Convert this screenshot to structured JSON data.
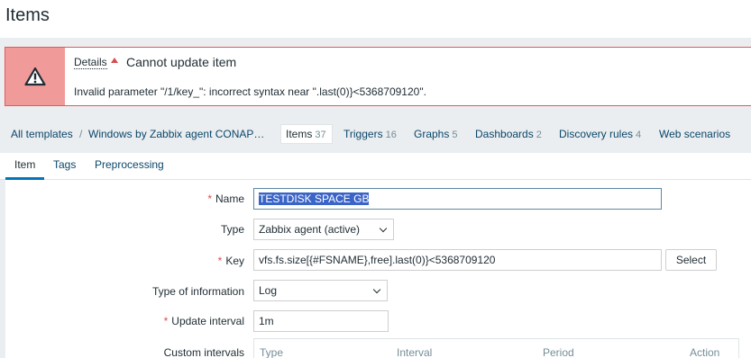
{
  "page": {
    "title": "Items"
  },
  "message": {
    "details_label": "Details",
    "title": "Cannot update item",
    "detail": "Invalid parameter \"/1/key_\": incorrect syntax near \".last(0)}<5368709120\".",
    "colors": {
      "border": "#e45959",
      "icon_bg": "#f19a9a"
    }
  },
  "nav": {
    "all_templates": "All templates",
    "separator": "/",
    "template": "Windows by Zabbix agent CONAP…",
    "items_label": "Items",
    "items_count": "37",
    "triggers_label": "Triggers",
    "triggers_count": "16",
    "graphs_label": "Graphs",
    "graphs_count": "5",
    "dashboards_label": "Dashboards",
    "dashboards_count": "2",
    "discovery_label": "Discovery rules",
    "discovery_count": "4",
    "web_label": "Web scenarios"
  },
  "tabs": {
    "item": "Item",
    "tags": "Tags",
    "preprocessing": "Preprocessing"
  },
  "form": {
    "required_mark": "*",
    "name_label": "Name",
    "name_value": "TESTDISK SPACE GB",
    "type_label": "Type",
    "type_value": "Zabbix agent (active)",
    "key_label": "Key",
    "key_value": "vfs.fs.size[{#FSNAME},free].last(0)}<5368709120",
    "select_button": "Select",
    "info_type_label": "Type of information",
    "info_type_value": "Log",
    "interval_label": "Update interval",
    "interval_value": "1m",
    "custom_intervals_label": "Custom intervals",
    "ci_columns": {
      "type": "Type",
      "interval": "Interval",
      "period": "Period",
      "action": "Action"
    }
  },
  "colors": {
    "link": "#0a466a",
    "accent": "#0275b8",
    "required": "#d64e4e",
    "selection": "#3a64c7"
  }
}
